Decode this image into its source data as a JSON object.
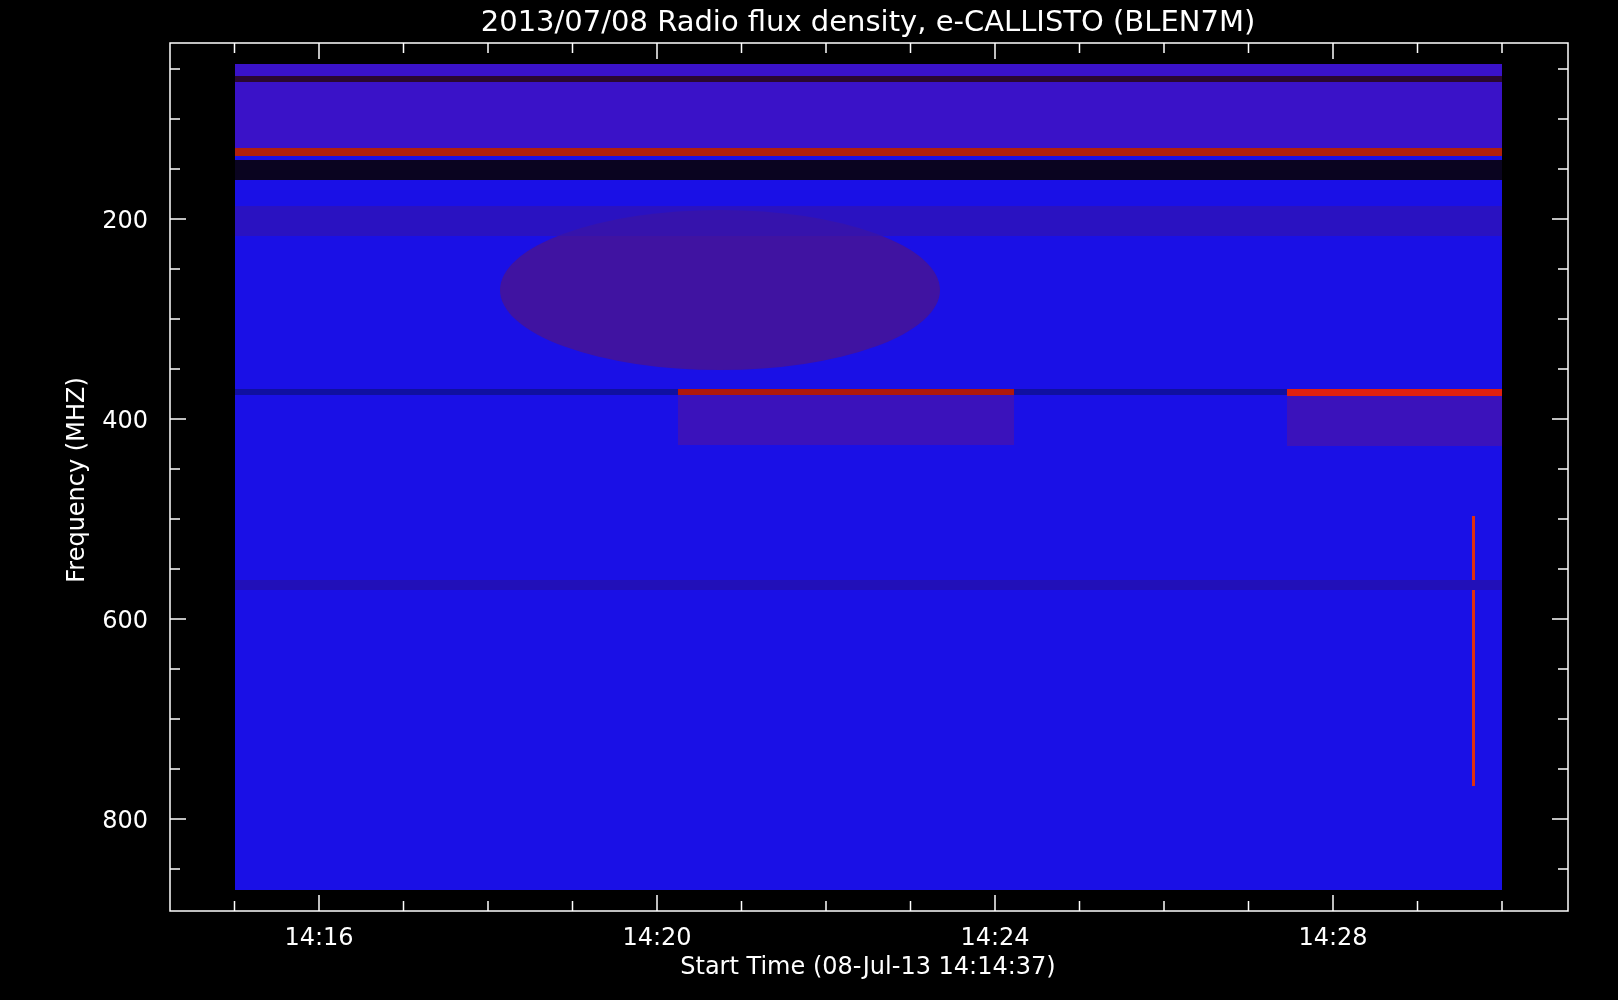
{
  "chart": {
    "title": "2013/07/08  Radio flux density, e-CALLISTO (BLEN7M)",
    "ylabel": "Frequency (MHZ)",
    "xlabel": "Start Time (08-Jul-13 14:14:37)",
    "yticks": [
      "200",
      "400",
      "600",
      "800"
    ],
    "xticks": [
      "14:16",
      "14:20",
      "14:24",
      "14:28"
    ]
  }
}
